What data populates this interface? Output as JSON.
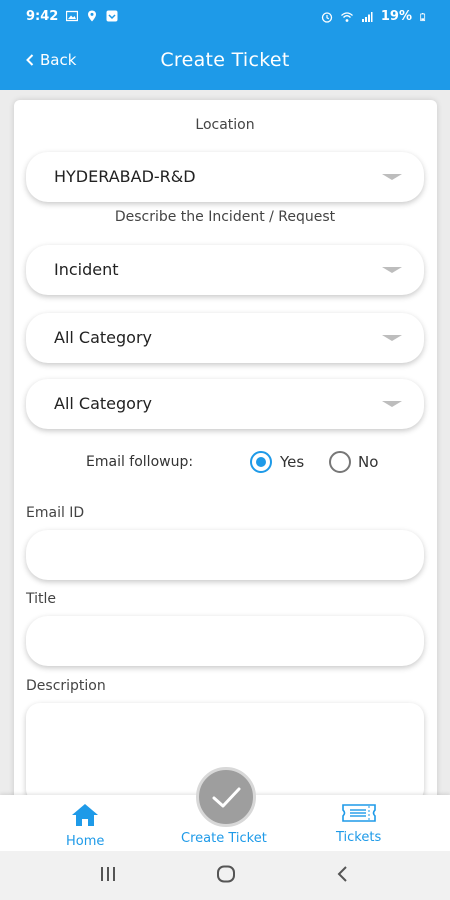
{
  "status_bar": {
    "time": "9:42",
    "battery": "19%",
    "icons_left": [
      "image-icon",
      "location-icon",
      "app-icon"
    ],
    "icons_right": [
      "alarm-icon",
      "wifi-icon",
      "signal-icon",
      "battery-icon"
    ]
  },
  "header": {
    "back_label": "Back",
    "title": "Create Ticket"
  },
  "form": {
    "location_label": "Location",
    "location_value": "HYDERABAD-R&D",
    "describe_label": "Describe the Incident / Request",
    "type_value": "Incident",
    "category1_value": "All Category",
    "category2_value": "All Category",
    "email_followup_label": "Email followup:",
    "followup_options": [
      "Yes",
      "No"
    ],
    "followup_selected": "Yes",
    "email_label": "Email ID",
    "email_value": "",
    "title_label": "Title",
    "title_value": "",
    "description_label": "Description",
    "description_value": ""
  },
  "tabbar": {
    "home_label": "Home",
    "create_label": "Create Ticket",
    "tickets_label": "Tickets"
  },
  "colors": {
    "accent": "#1e9ae8",
    "fab": "#9e9e9e"
  }
}
